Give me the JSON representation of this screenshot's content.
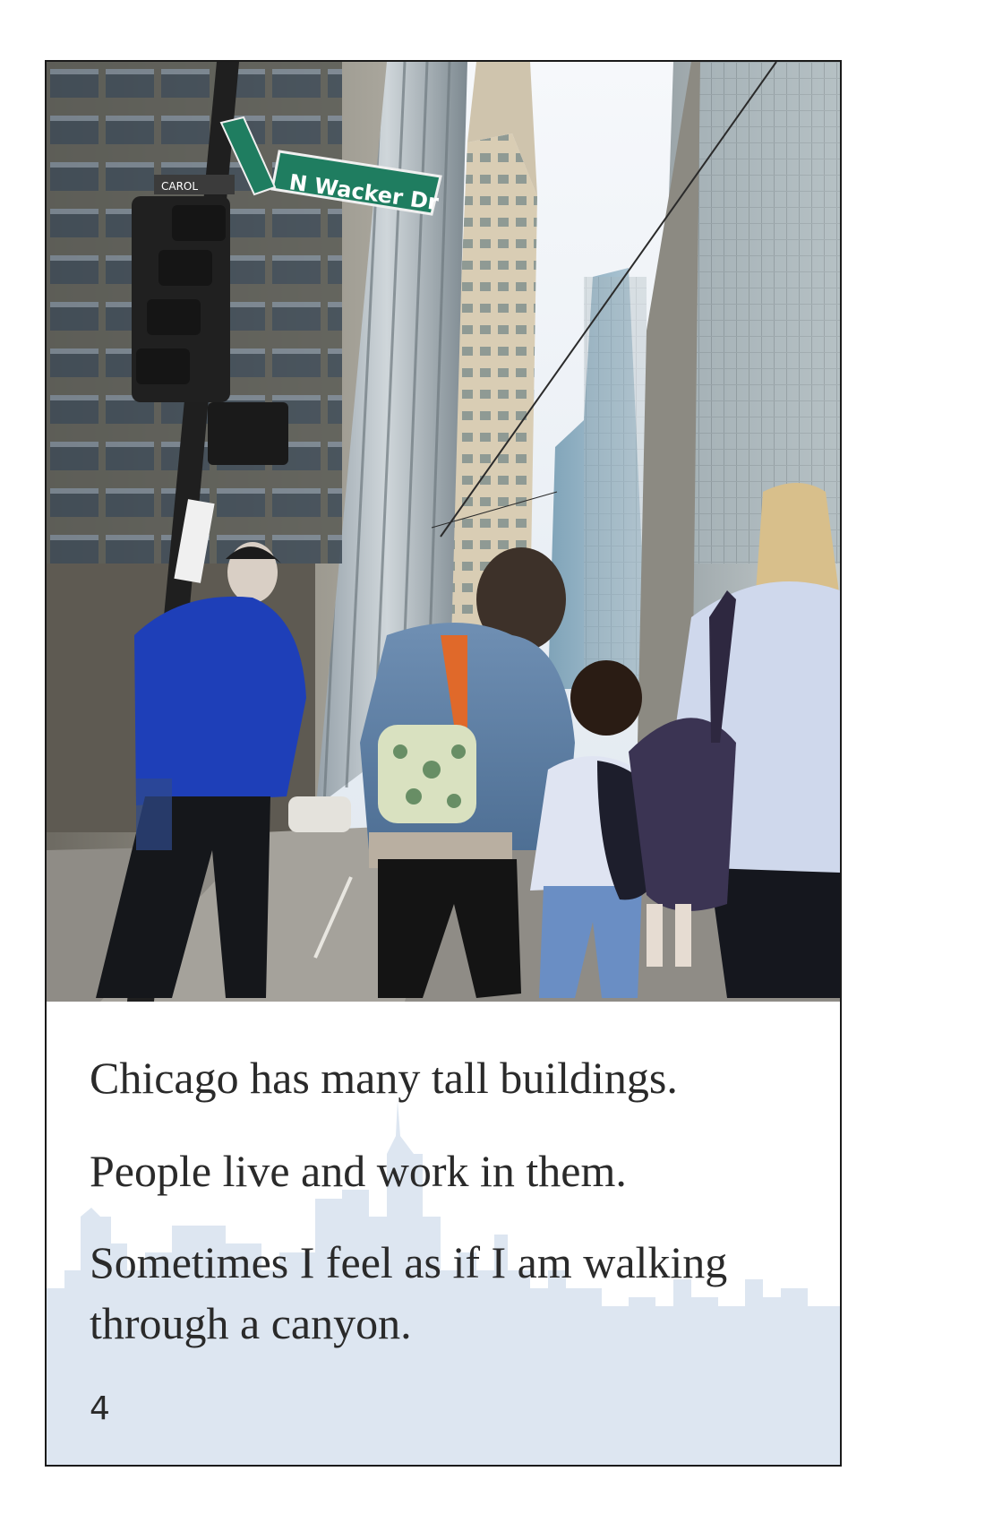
{
  "page": {
    "sentences": [
      "Chicago has many tall buildings.",
      "People live and work in them.",
      "Sometimes I feel as if I am walking through a canyon."
    ],
    "page_number": "4"
  },
  "photo": {
    "street_sign": "N Wacker Dr",
    "cross_street_sign": "CAROL"
  },
  "colors": {
    "skyline": "#dde6f1",
    "sky": "#e9eff6",
    "text": "#2a2a2a",
    "street_sign_green": "#1f7d60"
  }
}
